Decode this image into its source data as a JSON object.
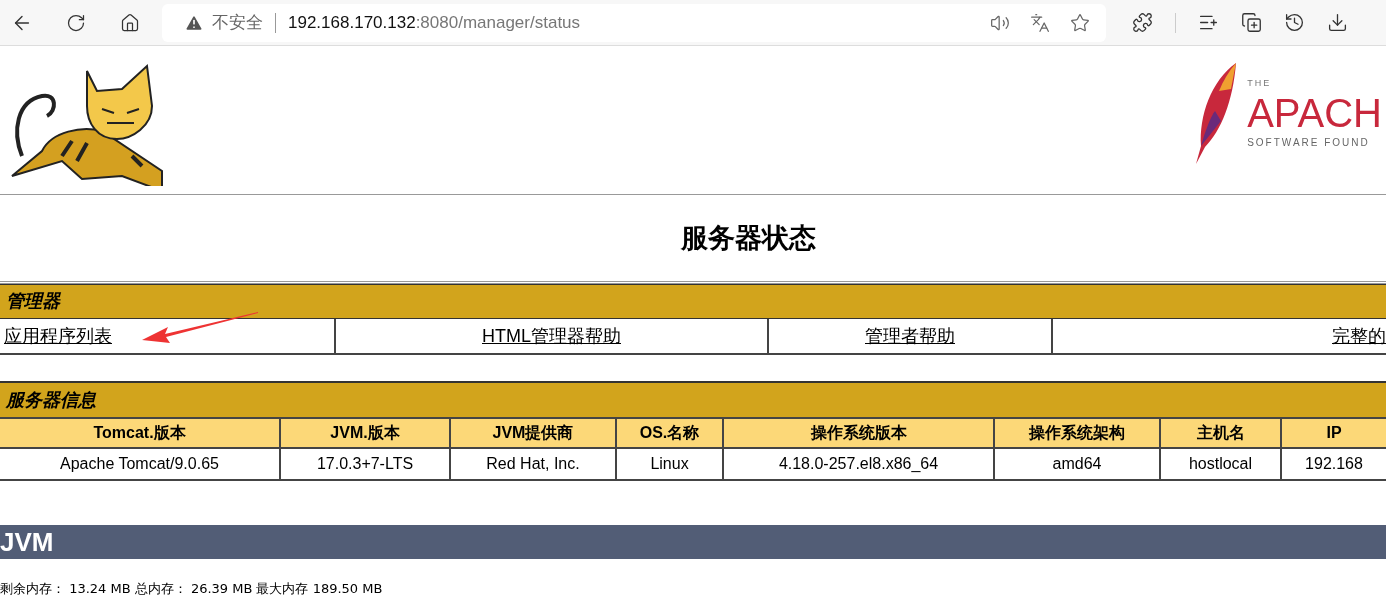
{
  "address_bar": {
    "security_label": "不安全",
    "host": "192.168.170.132",
    "path": ":8080/manager/status"
  },
  "apache_logo": {
    "the": "THE",
    "name": "APACH",
    "tagline": "SOFTWARE FOUND"
  },
  "title": "服务器状态",
  "manager": {
    "heading": "管理器",
    "links": [
      {
        "label": "应用程序列表"
      },
      {
        "label": "HTML管理器帮助"
      },
      {
        "label": "管理者帮助"
      },
      {
        "label": "完整的"
      }
    ]
  },
  "server_info": {
    "heading": "服务器信息",
    "columns": [
      "Tomcat.版本",
      "JVM.版本",
      "JVM提供商",
      "OS.名称",
      "操作系统版本",
      "操作系统架构",
      "主机名",
      "IP"
    ],
    "row": [
      "Apache Tomcat/9.0.65",
      "17.0.3+7-LTS",
      "Red Hat, Inc.",
      "Linux",
      "4.18.0-257.el8.x86_64",
      "amd64",
      "hostlocal",
      "192.168"
    ]
  },
  "jvm": {
    "heading": "JVM",
    "memory": "剩余内存： 13.24 MB 总内存： 26.39 MB 最大内存 189.50 MB"
  }
}
